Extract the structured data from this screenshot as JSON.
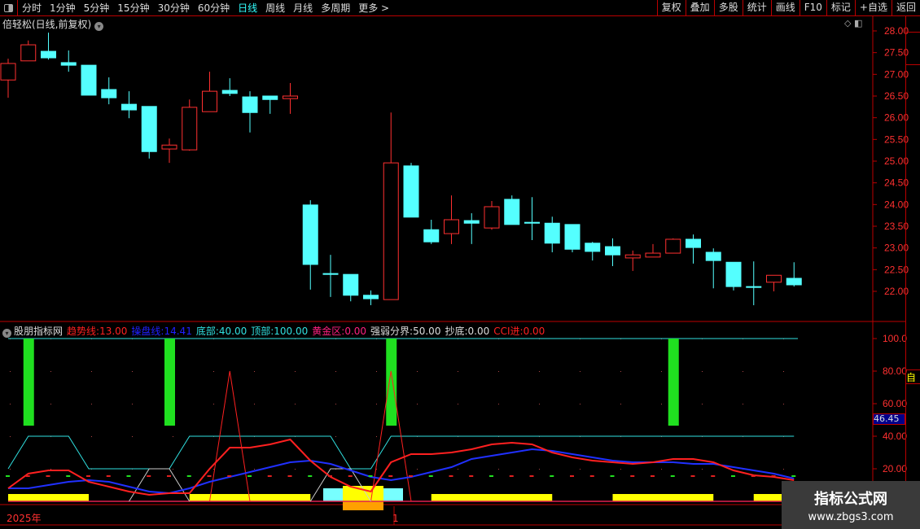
{
  "toolbar": {
    "periods": [
      "分时",
      "1分钟",
      "5分钟",
      "15分钟",
      "30分钟",
      "60分钟",
      "日线",
      "周线",
      "月线",
      "多周期",
      "更多 >"
    ],
    "active": "日线",
    "buttons": [
      "复权",
      "叠加",
      "多股",
      "统计",
      "画线",
      "F10",
      "标记",
      "+自选",
      "返回"
    ]
  },
  "main": {
    "title": "倍轻松(日线,前复权)",
    "price_ticks": [
      "28.00",
      "27.50",
      "27.00",
      "26.50",
      "26.00",
      "25.50",
      "25.00",
      "24.50",
      "24.00",
      "23.50",
      "23.00",
      "22.50",
      "22.00"
    ]
  },
  "indicator": {
    "name": "股朋指标网",
    "legend": [
      {
        "label": "趋势线:",
        "value": "13.00",
        "color": "#ff2020"
      },
      {
        "label": "操盘线:",
        "value": "14.41",
        "color": "#2020ff"
      },
      {
        "label": "底部:",
        "value": "40.00",
        "color": "#30e0e0"
      },
      {
        "label": "顶部:",
        "value": "100.00",
        "color": "#30e0e0"
      },
      {
        "label": "黄金区:",
        "value": "0.00",
        "color": "#ff2080"
      },
      {
        "label": "强弱分界:",
        "value": "50.00",
        "color": "#dddddd"
      },
      {
        "label": "抄底:",
        "value": "0.00",
        "color": "#dddddd"
      },
      {
        "label": "CCI进:",
        "value": "0.00",
        "color": "#ff2020"
      }
    ],
    "ticks": [
      "100.0",
      "80.00",
      "60.00",
      "40.00",
      "20.00"
    ],
    "current": "46.45"
  },
  "time_axis": {
    "labels": [
      "2025年",
      "1"
    ]
  },
  "watermark": {
    "name": "指标公式网",
    "url": "www.zbgs3.com"
  },
  "side_strip": {
    "top": "自"
  },
  "colors": {
    "up": "#ff3030",
    "down": "#54ffff",
    "trend": "#ff2020",
    "op": "#2030ff",
    "band": "#30e0e0",
    "green": "#20e020",
    "yellow": "#ffff00",
    "orange": "#ffa000"
  },
  "chart_data": {
    "type": "candlestick",
    "ylim": [
      21.6,
      28.2
    ],
    "candles": [
      [
        26.87,
        27.25,
        27.36,
        26.46
      ],
      [
        27.31,
        27.68,
        27.78,
        27.31
      ],
      [
        27.53,
        27.38,
        27.96,
        27.34
      ],
      [
        27.27,
        27.21,
        27.55,
        27.06
      ],
      [
        27.21,
        26.52,
        27.21,
        26.52
      ],
      [
        26.65,
        26.46,
        26.93,
        26.31
      ],
      [
        26.31,
        26.18,
        26.61,
        25.99
      ],
      [
        26.26,
        25.22,
        26.26,
        25.06
      ],
      [
        25.28,
        25.37,
        25.52,
        24.96
      ],
      [
        25.26,
        26.24,
        26.42,
        25.24
      ],
      [
        26.14,
        26.61,
        27.06,
        26.14
      ],
      [
        26.63,
        26.56,
        26.91,
        26.5
      ],
      [
        26.48,
        26.12,
        26.61,
        25.66
      ],
      [
        26.5,
        26.42,
        26.5,
        26.09
      ],
      [
        26.44,
        26.5,
        26.8,
        26.09
      ],
      [
        23.99,
        22.62,
        24.1,
        22.04
      ],
      [
        22.41,
        22.39,
        22.84,
        21.87
      ],
      [
        22.39,
        21.91,
        22.39,
        21.77
      ],
      [
        21.91,
        21.83,
        22.02,
        21.68
      ],
      [
        21.81,
        24.96,
        26.12,
        21.81
      ],
      [
        24.89,
        23.71,
        24.96,
        23.71
      ],
      [
        23.42,
        23.14,
        23.65,
        23.09
      ],
      [
        23.33,
        23.65,
        24.21,
        23.09
      ],
      [
        23.63,
        23.57,
        23.8,
        23.09
      ],
      [
        23.46,
        23.95,
        24.08,
        23.42
      ],
      [
        24.12,
        23.54,
        24.21,
        23.54
      ],
      [
        23.59,
        23.57,
        24.17,
        23.18
      ],
      [
        23.57,
        23.11,
        23.72,
        22.9
      ],
      [
        23.54,
        22.97,
        23.54,
        22.9
      ],
      [
        23.11,
        22.92,
        23.14,
        22.71
      ],
      [
        23.03,
        22.84,
        23.22,
        22.58
      ],
      [
        22.77,
        22.84,
        22.94,
        22.47
      ],
      [
        22.79,
        22.88,
        23.09,
        22.79
      ],
      [
        22.88,
        23.2,
        23.22,
        22.88
      ],
      [
        23.2,
        23.01,
        23.31,
        22.64
      ],
      [
        22.9,
        22.71,
        22.99,
        22.07
      ],
      [
        22.67,
        22.11,
        22.67,
        22.02
      ],
      [
        22.11,
        22.09,
        22.69,
        21.68
      ],
      [
        22.21,
        22.37,
        22.37,
        22.0
      ],
      [
        22.3,
        22.15,
        22.67,
        22.11
      ]
    ],
    "indicator": {
      "ylim": [
        0,
        100
      ],
      "trend": [
        8,
        17,
        19,
        19,
        12,
        9,
        6,
        4,
        5,
        5,
        20,
        33,
        33,
        35,
        38,
        25,
        15,
        9,
        6,
        24,
        29,
        29,
        30,
        32,
        35,
        36,
        35,
        30,
        27,
        25,
        24,
        23,
        24,
        26,
        26,
        24,
        19,
        16,
        15,
        13
      ],
      "op": [
        8,
        8,
        10,
        12,
        13,
        12,
        9,
        6,
        5,
        8,
        12,
        15,
        18,
        21,
        24,
        25,
        23,
        19,
        15,
        13,
        15,
        18,
        21,
        26,
        28,
        30,
        32,
        31,
        29,
        27,
        25,
        24,
        24,
        24,
        23,
        23,
        21,
        19,
        17,
        14
      ],
      "band": [
        20,
        40,
        40,
        40,
        20,
        20,
        20,
        20,
        20,
        40,
        40,
        40,
        40,
        40,
        40,
        40,
        40,
        20,
        20,
        40,
        40,
        40,
        40,
        40,
        40,
        40,
        40,
        40,
        40,
        40,
        40,
        40,
        40,
        40,
        40,
        40,
        40,
        40,
        40,
        40
      ],
      "green_bars": [
        1,
        8,
        19,
        33
      ],
      "spikes": [
        11,
        19
      ],
      "yellow_segments": [
        [
          0,
          4
        ],
        [
          9,
          15
        ],
        [
          21,
          27
        ],
        [
          30,
          35
        ],
        [
          37,
          39
        ]
      ]
    }
  }
}
